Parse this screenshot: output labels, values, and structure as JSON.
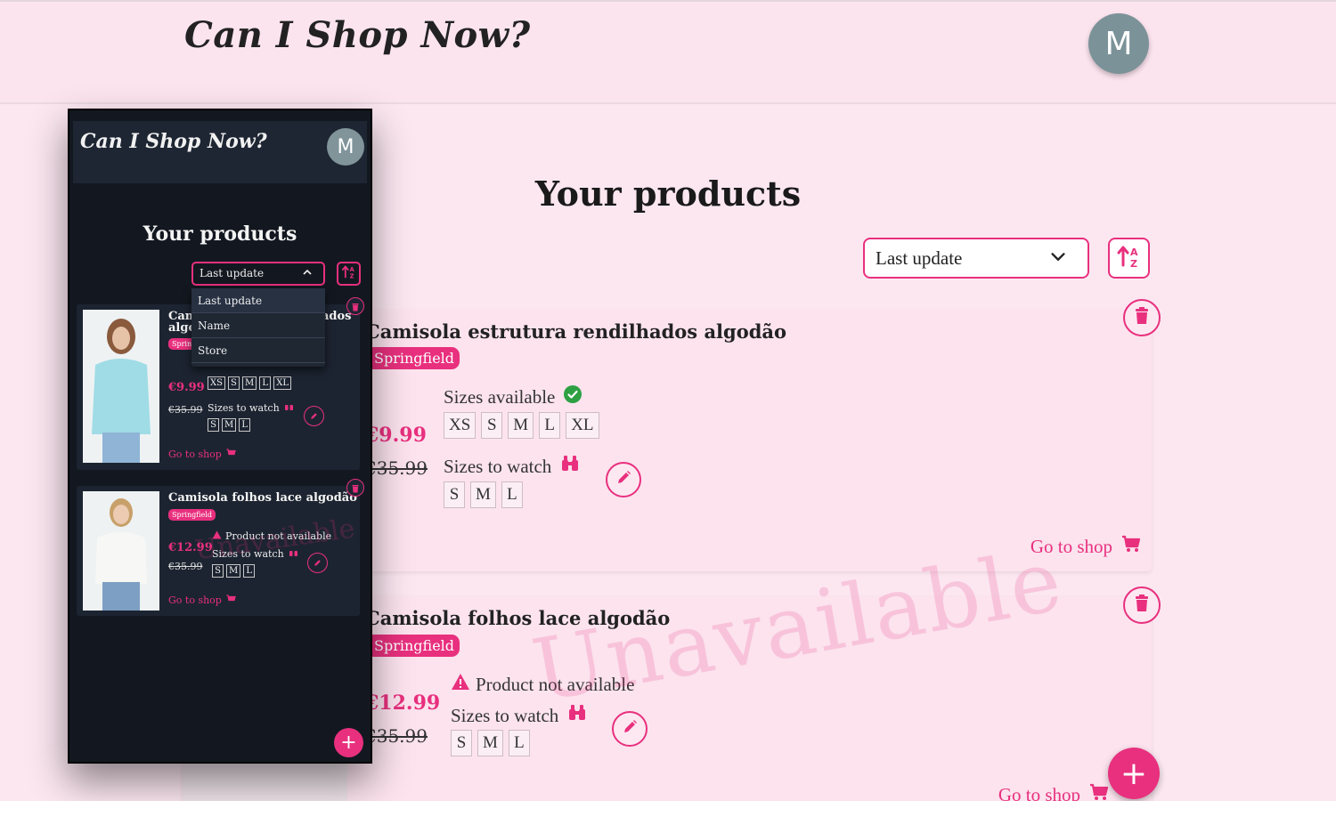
{
  "app": {
    "brand": "Can I Shop Now?",
    "avatar_initial": "M"
  },
  "page": {
    "title": "Your products"
  },
  "sort": {
    "selected": "Last update",
    "options": [
      "Last update",
      "Name",
      "Store"
    ]
  },
  "products": [
    {
      "name": "Camisola estrutura rendilhados algodão",
      "store": "Springfield",
      "price_now": "€9.99",
      "price_old": "€35.99",
      "available": true,
      "sizes_available_label": "Sizes available",
      "sizes_available": [
        "XS",
        "S",
        "M",
        "L",
        "XL"
      ],
      "sizes_watch_label": "Sizes to watch",
      "sizes_watch": [
        "S",
        "M",
        "L"
      ],
      "go_to_shop": "Go to shop"
    },
    {
      "name": "Camisola folhos lace algodão",
      "store": "Springfield",
      "price_now": "€12.99",
      "price_old": "€35.99",
      "available": false,
      "unavailable_label": "Product not available",
      "sizes_watch_label": "Sizes to watch",
      "sizes_watch": [
        "S",
        "M",
        "L"
      ],
      "go_to_shop": "Go to shop",
      "watermark": "Unavailable"
    }
  ],
  "mobile_preview": {
    "card1_name_line1": "Cam",
    "card1_name_line2": "algo",
    "card1_name_tail": "ados",
    "card1_tag_fragment": "Sprin",
    "card1_partial_label": "Sizes available"
  },
  "colors": {
    "accent": "#e8307e",
    "background": "#fce7f1",
    "dark_bg": "#131820",
    "success": "#2ea043"
  },
  "icons": [
    "trash-icon",
    "pencil-icon",
    "cart-icon",
    "binoculars-icon",
    "check-circle-icon",
    "warning-icon",
    "sort-az-icon",
    "plus-icon",
    "chevron-down-icon",
    "chevron-up-icon"
  ]
}
